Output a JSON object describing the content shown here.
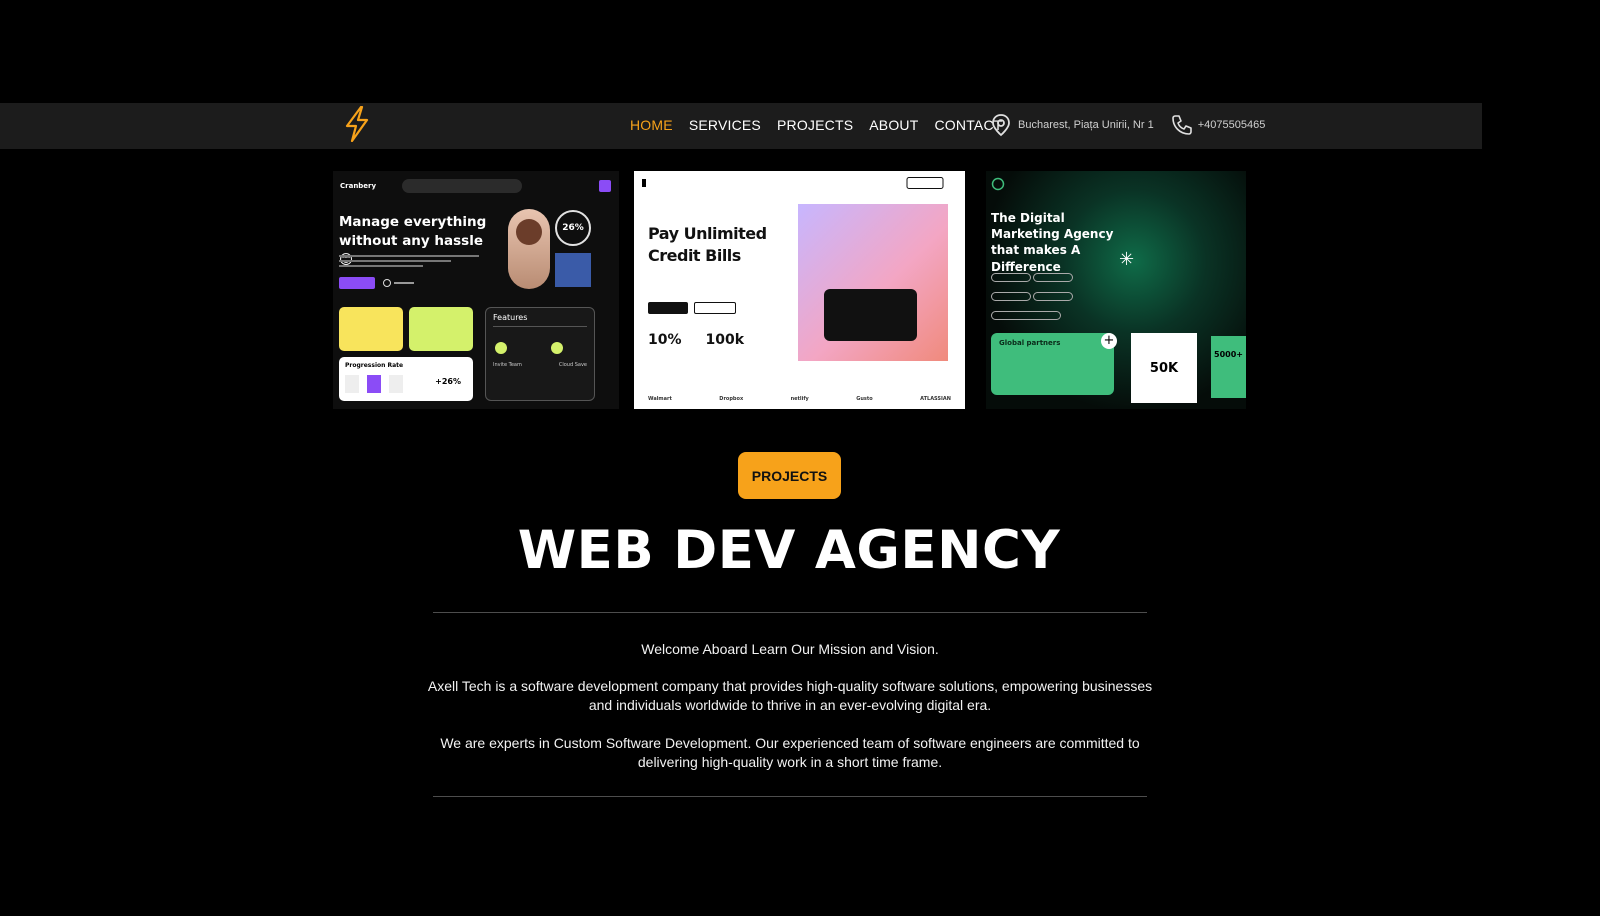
{
  "nav": {
    "items": [
      "HOME",
      "SERVICES",
      "PROJECTS",
      "ABOUT",
      "CONTACT"
    ],
    "active_index": 0,
    "address": "Bucharest, Piața Unirii, Nr 1",
    "phone": "+4075505465"
  },
  "colors": {
    "accent": "#f7a21a",
    "navbar_bg": "#1c1c1c",
    "page_bg": "#000000"
  },
  "showcase": {
    "shot1": {
      "brand": "Cranbery",
      "headline": "Manage everything without any hassle 😊",
      "stat": "26%",
      "card_label": "Progression Rate",
      "card_value": "+26%",
      "features_title": "Features",
      "feature_a": "Invite Team",
      "feature_b": "Cloud Save"
    },
    "shot2": {
      "headline": "Pay Unlimited Credit Bills",
      "stat_a": "10%",
      "stat_b": "100k",
      "footer": [
        "Walmart",
        "Dropbox",
        "netlify",
        "Gusto",
        "ATLASSIAN"
      ]
    },
    "shot3": {
      "headline": "The Digital Marketing Agency that makes A Difference",
      "card_label": "Global partners",
      "stat": "50K",
      "edge_stat": "5000+"
    }
  },
  "badge": "PROJECTS",
  "headline": "WEB DEV AGENCY",
  "intro": "Welcome Aboard Learn Our Mission and Vision.",
  "paragraph1": "Axell Tech is a software development company that provides high-quality software solutions, empowering businesses and individuals worldwide to thrive in an ever-evolving digital era.",
  "paragraph2": "We are experts in Custom Software Development. Our experienced team of software engineers are committed to delivering high-quality work in a short time frame."
}
